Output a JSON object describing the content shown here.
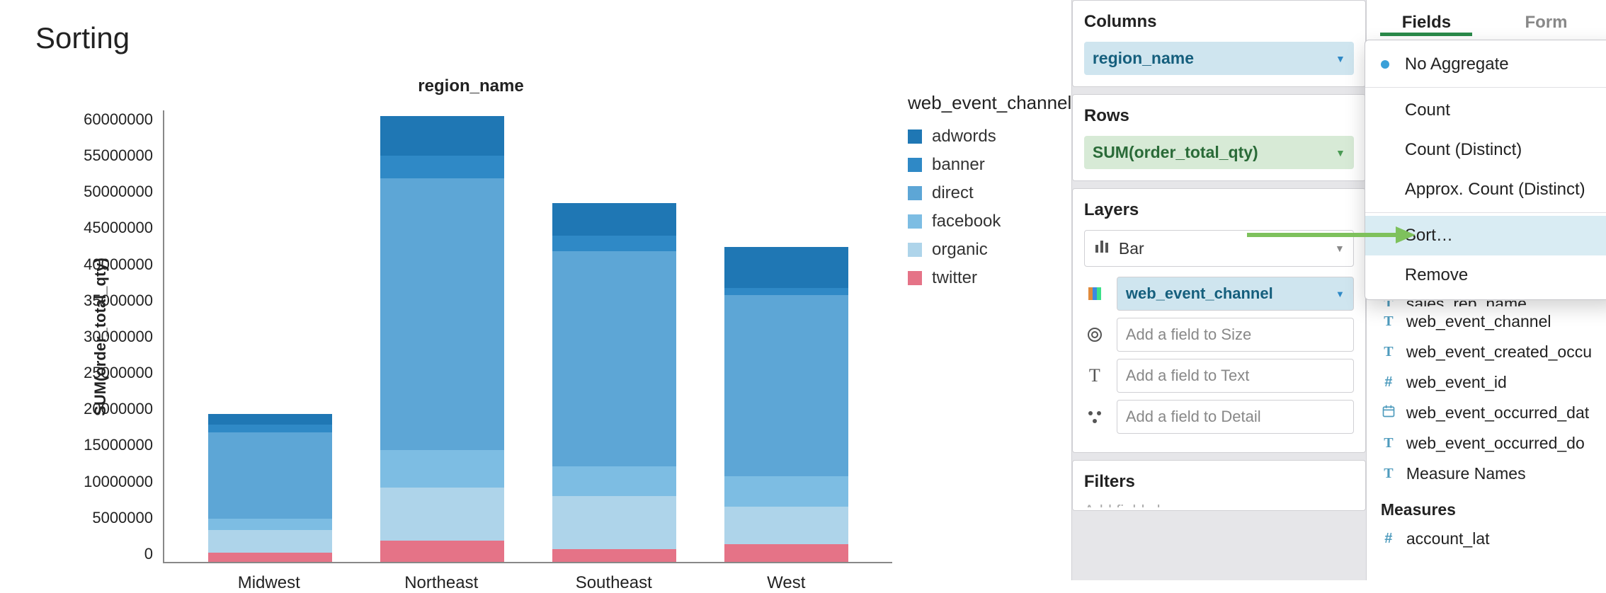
{
  "page_title": "Sorting",
  "chart_data": {
    "type": "bar",
    "stacked": true,
    "title": "region_name",
    "ylabel": "SUM(order_total_qty)",
    "xlabel": "",
    "ylim": [
      0,
      60000000
    ],
    "y_ticks": [
      "60000000",
      "55000000",
      "50000000",
      "45000000",
      "40000000",
      "35000000",
      "30000000",
      "25000000",
      "20000000",
      "15000000",
      "10000000",
      "5000000",
      "0"
    ],
    "categories": [
      "Midwest",
      "Northeast",
      "Southeast",
      "West"
    ],
    "series": [
      {
        "name": "adwords",
        "color": "#1f77b4",
        "values": [
          1400000,
          5300000,
          4300000,
          5400000
        ]
      },
      {
        "name": "banner",
        "color": "#2f89c6",
        "values": [
          1000000,
          3000000,
          2000000,
          1000000
        ]
      },
      {
        "name": "direct",
        "color": "#5da6d6",
        "values": [
          11500000,
          36000000,
          28500000,
          24000000
        ]
      },
      {
        "name": "facebook",
        "color": "#7dbde3",
        "values": [
          1500000,
          5000000,
          4000000,
          4000000
        ]
      },
      {
        "name": "organic",
        "color": "#aed4ea",
        "values": [
          3000000,
          7000000,
          7000000,
          5000000
        ]
      },
      {
        "name": "twitter",
        "color": "#e57387",
        "values": [
          1200000,
          2800000,
          1700000,
          2300000
        ]
      }
    ],
    "legend_title": "web_event_channel"
  },
  "config": {
    "columns_label": "Columns",
    "columns_pill": "region_name",
    "rows_label": "Rows",
    "rows_pill": "SUM(order_total_qty)",
    "layers_label": "Layers",
    "chart_type": "Bar",
    "color_field": "web_event_channel",
    "size_placeholder": "Add a field to Size",
    "text_placeholder": "Add a field to Text",
    "detail_placeholder": "Add a field to Detail",
    "filters_label": "Filters",
    "filters_placeholder": "Add fields here"
  },
  "ctx_menu": {
    "items": [
      "No Aggregate",
      "Count",
      "Count (Distinct)",
      "Approx. Count (Distinct)",
      "Sort…",
      "Remove"
    ],
    "selected": "No Aggregate",
    "highlight": "Sort…"
  },
  "fields_panel": {
    "tabs": [
      "Fields",
      "Form"
    ],
    "active_tab": "Fields",
    "fields": [
      {
        "icon": "T",
        "name": "sales_rep_name"
      },
      {
        "icon": "T",
        "name": "web_event_channel"
      },
      {
        "icon": "T",
        "name": "web_event_created_occu"
      },
      {
        "icon": "#",
        "name": "web_event_id"
      },
      {
        "icon": "cal",
        "name": "web_event_occurred_dat"
      },
      {
        "icon": "T",
        "name": "web_event_occurred_do"
      },
      {
        "icon": "T",
        "name": "Measure Names"
      }
    ],
    "measures_label": "Measures",
    "measures": [
      {
        "icon": "#",
        "name": "account_lat"
      }
    ]
  },
  "colors": {
    "pill_blue_bg": "#cfe5ef",
    "pill_green_bg": "#d7ead6",
    "arrow": "#7ec15c"
  }
}
